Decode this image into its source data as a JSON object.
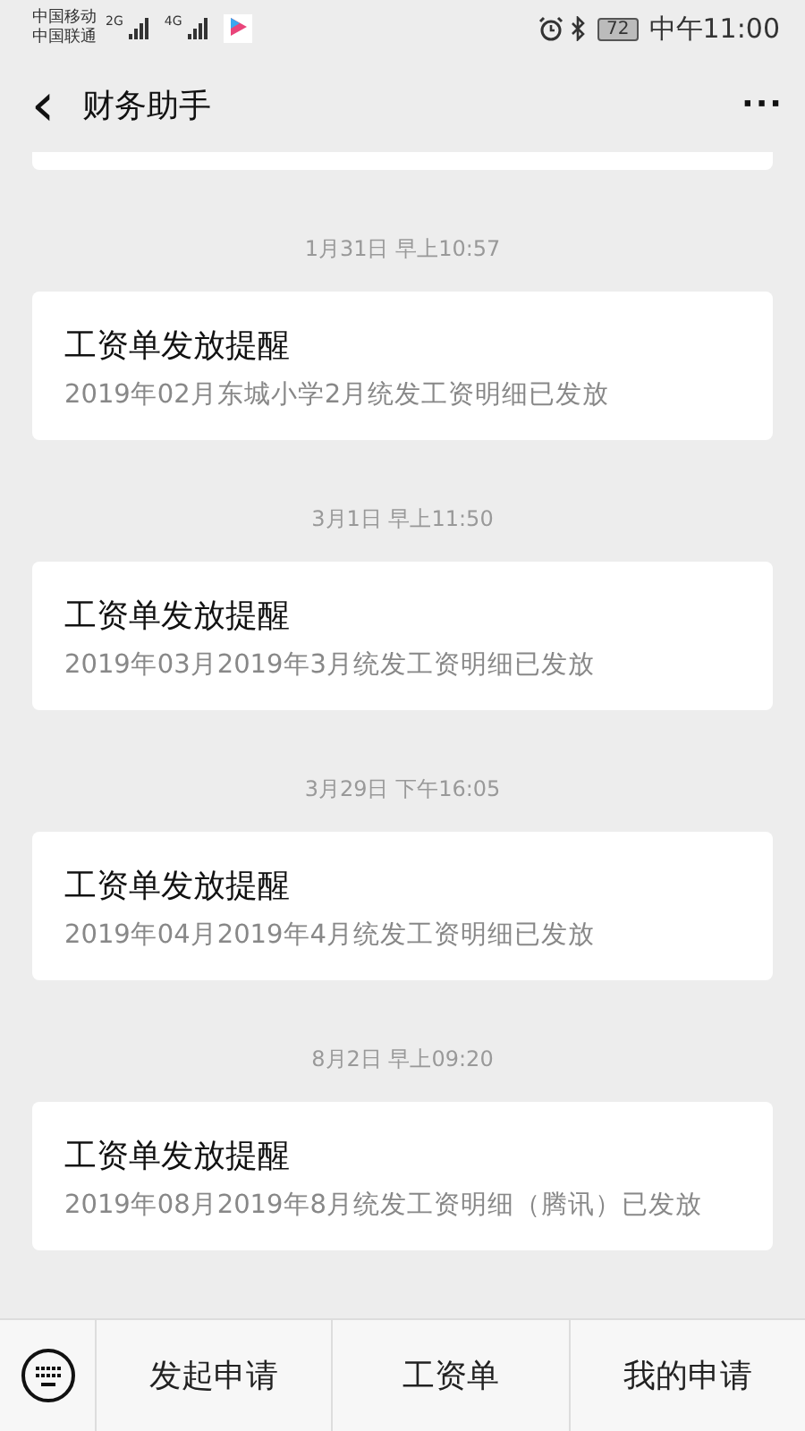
{
  "status_bar": {
    "carriers": [
      "中国移动",
      "中国联通"
    ],
    "networks": [
      "2G",
      "4G"
    ],
    "battery": "72",
    "time": "中午11:00"
  },
  "header": {
    "back": "‹",
    "title": "财务助手",
    "more": "···"
  },
  "messages": [
    {
      "time": "1月31日 早上10:57",
      "title": "工资单发放提醒",
      "body": "2019年02月东城小学2月统发工资明细已发放"
    },
    {
      "time": "3月1日 早上11:50",
      "title": "工资单发放提醒",
      "body": "2019年03月2019年3月统发工资明细已发放"
    },
    {
      "time": "3月29日 下午16:05",
      "title": "工资单发放提醒",
      "body": "2019年04月2019年4月统发工资明细已发放"
    },
    {
      "time": "8月2日 早上09:20",
      "title": "工资单发放提醒",
      "body": "2019年08月2019年8月统发工资明细（腾讯）已发放"
    }
  ],
  "bottom_menu": [
    "发起申请",
    "工资单",
    "我的申请"
  ]
}
